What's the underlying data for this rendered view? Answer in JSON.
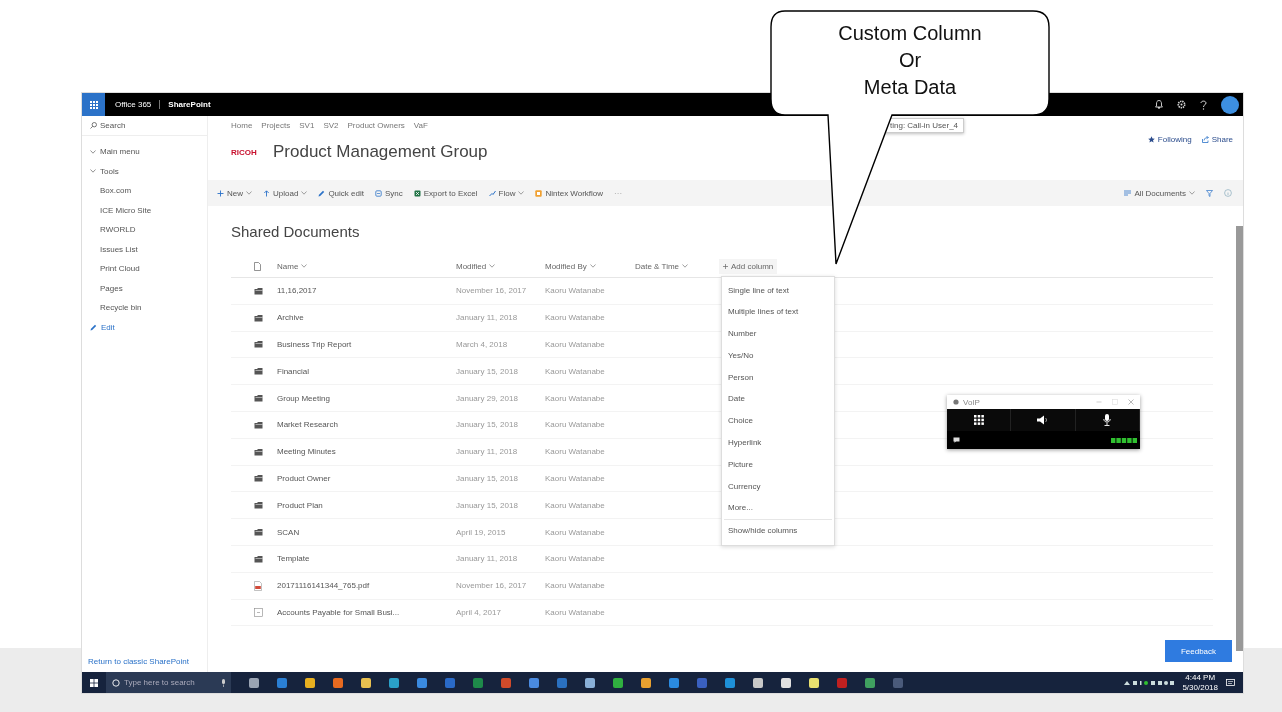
{
  "callout": {
    "lines": [
      "Custom Column",
      "Or",
      "Meta Data"
    ]
  },
  "suite_bar": {
    "app_name": "Office 365",
    "product": "SharePoint"
  },
  "sidebar": {
    "search": {
      "placeholder": "Search"
    },
    "items": [
      {
        "label": "Main menu",
        "kind": "group"
      },
      {
        "label": "Tools",
        "kind": "group"
      },
      {
        "label": "Box.com",
        "kind": "link"
      },
      {
        "label": "ICE Micro Site",
        "kind": "link"
      },
      {
        "label": "RWORLD",
        "kind": "link"
      },
      {
        "label": "Issues List",
        "kind": "link"
      },
      {
        "label": "Print Cloud",
        "kind": "link"
      },
      {
        "label": "Pages",
        "kind": "link"
      },
      {
        "label": "Recycle bin",
        "kind": "link"
      },
      {
        "label": "Edit",
        "kind": "edit"
      }
    ],
    "footer_link": "Return to classic SharePoint"
  },
  "breadcrumb": [
    "Home",
    "Projects",
    "SV1",
    "SV2",
    "Product Owners",
    "VaF"
  ],
  "tooltip": "ting: Call-in User_4",
  "site": {
    "logo": "RICOH",
    "title": "Product Management Group",
    "actions": [
      {
        "label": "Following",
        "kind": "follow"
      },
      {
        "label": "Share",
        "kind": "share"
      }
    ]
  },
  "command_bar": {
    "items": [
      {
        "label": "New",
        "kind": "new",
        "dropdown": true
      },
      {
        "label": "Upload",
        "kind": "upload",
        "dropdown": true
      },
      {
        "label": "Quick edit",
        "kind": "edit",
        "dropdown": false
      },
      {
        "label": "Sync",
        "kind": "sync",
        "dropdown": false
      },
      {
        "label": "Export to Excel",
        "kind": "excel",
        "dropdown": false
      },
      {
        "label": "Flow",
        "kind": "flow",
        "dropdown": true
      },
      {
        "label": "Nintex Workflow",
        "kind": "nintex",
        "dropdown": false
      }
    ],
    "overflow": "···",
    "view": "All Documents"
  },
  "library": {
    "title": "Shared Documents",
    "columns": [
      "Name",
      "Modified",
      "Modified By",
      "Date & Time"
    ],
    "add_column": "Add column",
    "rows": [
      {
        "name": "11,16,2017",
        "kind": "folder",
        "modified": "November 16, 2017",
        "modified_by": "Kaoru Watanabe"
      },
      {
        "name": "Archive",
        "kind": "folder",
        "modified": "January 11, 2018",
        "modified_by": "Kaoru Watanabe"
      },
      {
        "name": "Business Trip Report",
        "kind": "folder",
        "modified": "March 4, 2018",
        "modified_by": "Kaoru Watanabe"
      },
      {
        "name": "Financial",
        "kind": "folder",
        "modified": "January 15, 2018",
        "modified_by": "Kaoru Watanabe"
      },
      {
        "name": "Group Meeting",
        "kind": "folder",
        "modified": "January 29, 2018",
        "modified_by": "Kaoru Watanabe"
      },
      {
        "name": "Market Research",
        "kind": "folder",
        "modified": "January 15, 2018",
        "modified_by": "Kaoru Watanabe"
      },
      {
        "name": "Meeting Minutes",
        "kind": "folder",
        "modified": "January 11, 2018",
        "modified_by": "Kaoru Watanabe"
      },
      {
        "name": "Product Owner",
        "kind": "folder",
        "modified": "January 15, 2018",
        "modified_by": "Kaoru Watanabe"
      },
      {
        "name": "Product Plan",
        "kind": "folder",
        "modified": "January 15, 2018",
        "modified_by": "Kaoru Watanabe"
      },
      {
        "name": "SCAN",
        "kind": "folder",
        "modified": "April 19, 2015",
        "modified_by": "Kaoru Watanabe"
      },
      {
        "name": "Template",
        "kind": "folder",
        "modified": "January 11, 2018",
        "modified_by": "Kaoru Watanabe"
      },
      {
        "name": "20171116141344_765.pdf",
        "kind": "pdf",
        "modified": "November 16, 2017",
        "modified_by": "Kaoru Watanabe"
      },
      {
        "name": "Accounts Payable for Small Busi...",
        "kind": "doc",
        "modified": "April 4, 2017",
        "modified_by": "Kaoru Watanabe"
      }
    ]
  },
  "add_column_menu": {
    "items": [
      "Single line of text",
      "Multiple lines of text",
      "Number",
      "Yes/No",
      "Person",
      "Date",
      "Choice",
      "Hyperlink",
      "Picture",
      "Currency",
      "More..."
    ],
    "footer": "Show/hide columns"
  },
  "voip": {
    "title": "VoIP"
  },
  "feedback": "Feedback",
  "taskbar": {
    "search_placeholder": "Type here to search",
    "apps": [
      {
        "color": "#9aa4b4"
      },
      {
        "color": "#2a7fd4"
      },
      {
        "color": "#e8b020"
      },
      {
        "color": "#e86a20"
      },
      {
        "color": "#e8c050"
      },
      {
        "color": "#2aa0c8"
      },
      {
        "color": "#3a8ae0"
      },
      {
        "color": "#2a6ac8"
      },
      {
        "color": "#1e8a4a"
      },
      {
        "color": "#d04a2a"
      },
      {
        "color": "#4a8ae0"
      },
      {
        "color": "#2a70c0"
      },
      {
        "color": "#8ab0d8"
      },
      {
        "color": "#30b040"
      },
      {
        "color": "#e8a030"
      },
      {
        "color": "#2a8ae0"
      },
      {
        "color": "#3a60c0"
      },
      {
        "color": "#1e90d8"
      },
      {
        "color": "#c8c8c8"
      },
      {
        "color": "#e0e0e0"
      },
      {
        "color": "#e8e070"
      },
      {
        "color": "#c02020"
      },
      {
        "color": "#40a060"
      },
      {
        "color": "#4a5a7a"
      }
    ],
    "time": "4:44 PM",
    "date": "5/30/2018"
  }
}
